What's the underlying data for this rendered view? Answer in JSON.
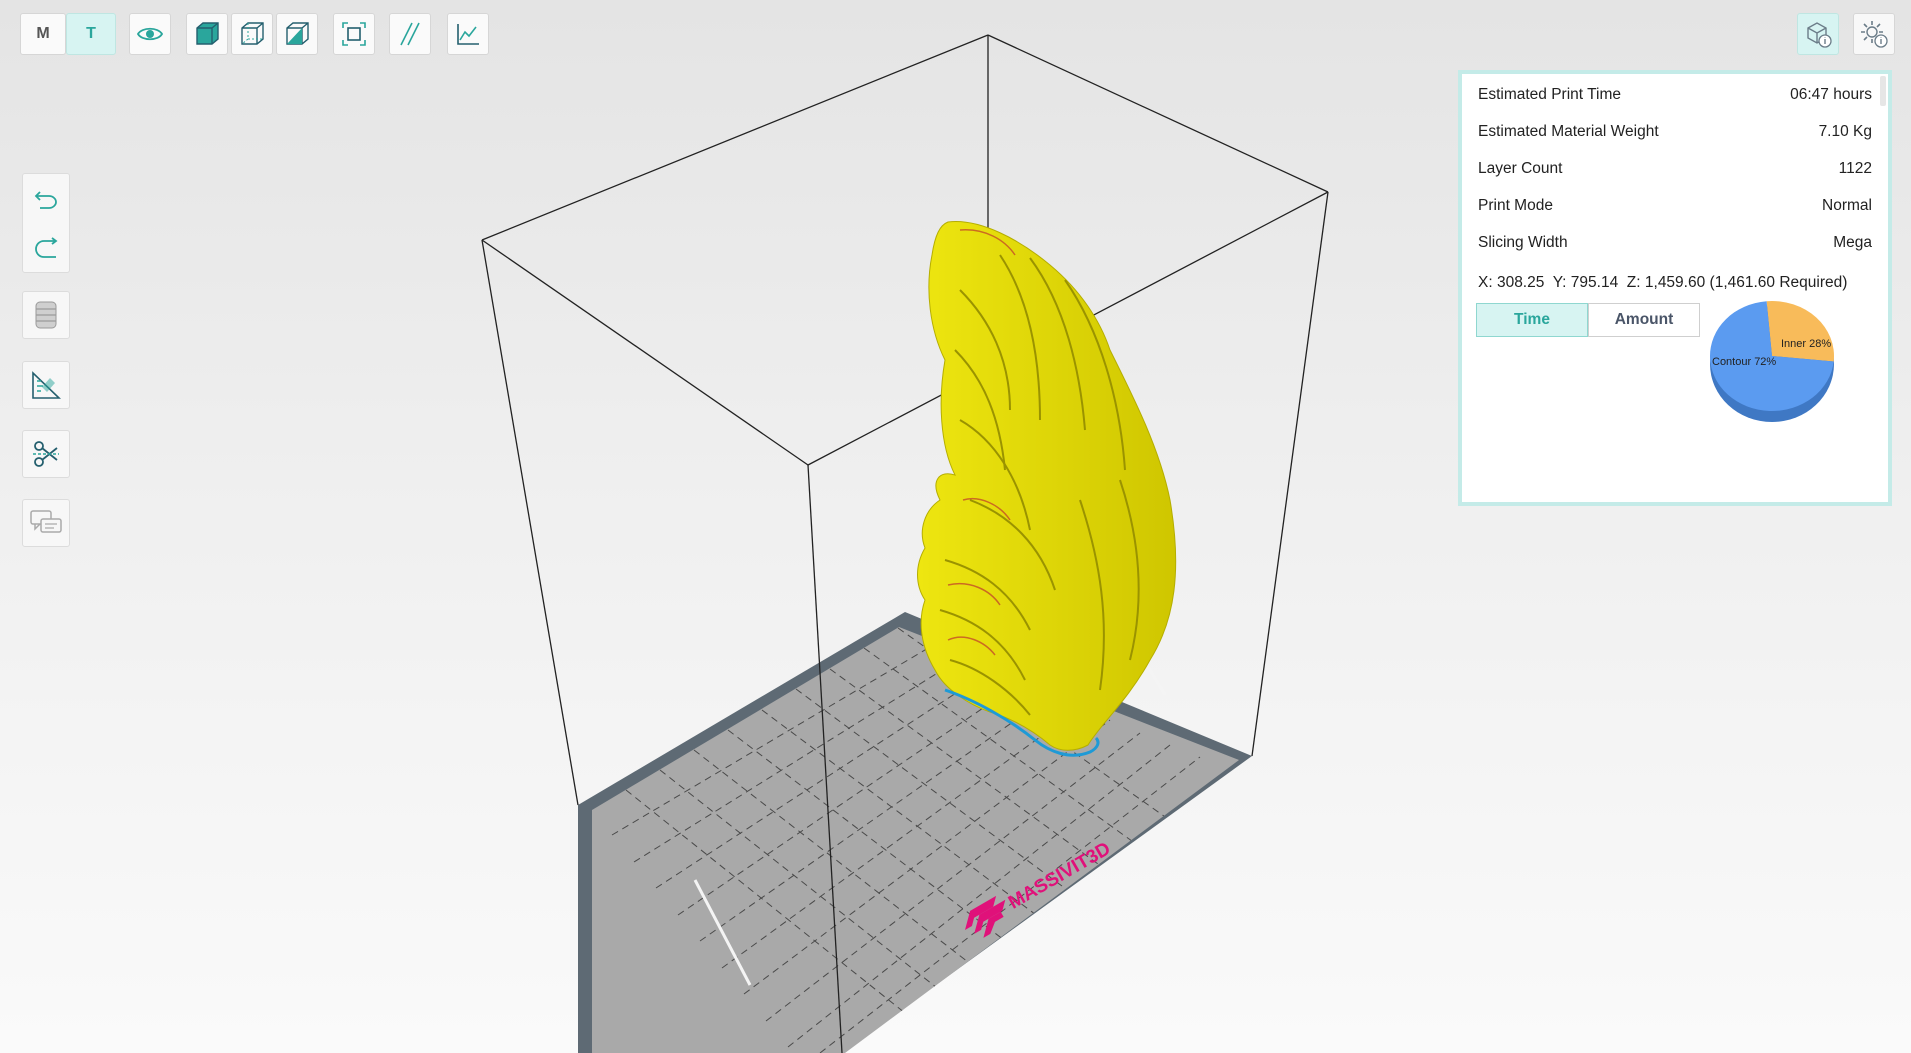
{
  "toolbar": {
    "mode_m": "M",
    "mode_t": "T",
    "active_mode": "T",
    "icons": [
      "eye-icon",
      "solid-view-icon",
      "wireframe-view-icon",
      "section-view-icon",
      "fit-view-icon",
      "slice-lines-icon",
      "chart-icon"
    ]
  },
  "side_toolbar": {
    "icons": [
      "undo-icon",
      "redo-icon",
      "material-spool-icon",
      "measure-ruler-icon",
      "cut-scissors-icon",
      "comments-icon"
    ]
  },
  "right_toolbar": {
    "icons": [
      "model-info-icon",
      "settings-info-icon"
    ],
    "active": "model-info-icon"
  },
  "print_info": {
    "rows": [
      {
        "label": "Estimated Print Time",
        "value": "06:47 hours"
      },
      {
        "label": "Estimated Material Weight",
        "value": "7.10 Kg"
      },
      {
        "label": "Layer Count",
        "value": "1122"
      },
      {
        "label": "Print Mode",
        "value": "Normal"
      },
      {
        "label": "Slicing Width",
        "value": "Mega"
      }
    ],
    "coordinates": "X: 308.25  Y: 795.14  Z: 1,459.60 (1,461.60 Required)",
    "tabs": {
      "time": "Time",
      "amount": "Amount",
      "active": "Time"
    }
  },
  "chart_data": {
    "type": "pie",
    "categories": [
      "Contour",
      "Inner"
    ],
    "values": [
      72,
      28
    ],
    "labels": [
      "Contour 72%",
      "Inner 28%"
    ],
    "colors": [
      "#5b9bf0",
      "#f8bb5a"
    ]
  },
  "scene": {
    "brand_logo_text": "MASSIVIT3D",
    "model_color": "#e8e10a",
    "bed_color": "#a8a8a8",
    "bed_frame_color": "#5d6a75",
    "logo_color": "#e0117a"
  }
}
